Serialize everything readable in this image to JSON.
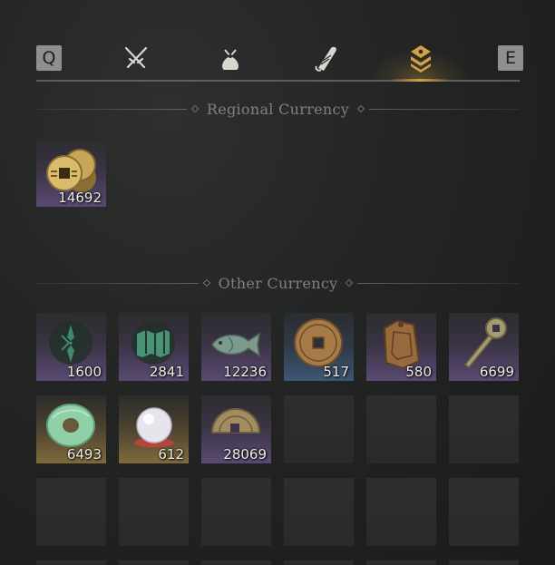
{
  "tabs": {
    "prev_key": "Q",
    "next_key": "E",
    "items": [
      {
        "icon": "crossed-swords-icon"
      },
      {
        "icon": "pouch-icon"
      },
      {
        "icon": "scroll-icon"
      },
      {
        "icon": "currency-stack-icon",
        "active": true
      }
    ],
    "active_color": "#d2a046"
  },
  "regional": {
    "title": "Regional Currency",
    "items": [
      {
        "icon": "copper-coins-pile-icon",
        "count": "14692",
        "rarity": "purple"
      }
    ]
  },
  "other": {
    "title": "Other Currency",
    "items": [
      {
        "icon": "jade-sigil-icon",
        "count": "1600",
        "rarity": "purple"
      },
      {
        "icon": "map-token-icon",
        "count": "2841",
        "rarity": "purple"
      },
      {
        "icon": "jade-fish-icon",
        "count": "12236",
        "rarity": "purple"
      },
      {
        "icon": "square-hole-coin-icon",
        "count": "517",
        "rarity": "blue"
      },
      {
        "icon": "bronze-plaque-icon",
        "count": "580",
        "rarity": "purple"
      },
      {
        "icon": "key-coin-icon",
        "count": "6699",
        "rarity": "purple"
      },
      {
        "icon": "jade-bi-disc-icon",
        "count": "6493",
        "rarity": "gold"
      },
      {
        "icon": "pearl-icon",
        "count": "612",
        "rarity": "gold"
      },
      {
        "icon": "half-coin-icon",
        "count": "28069",
        "rarity": "purple"
      }
    ]
  }
}
